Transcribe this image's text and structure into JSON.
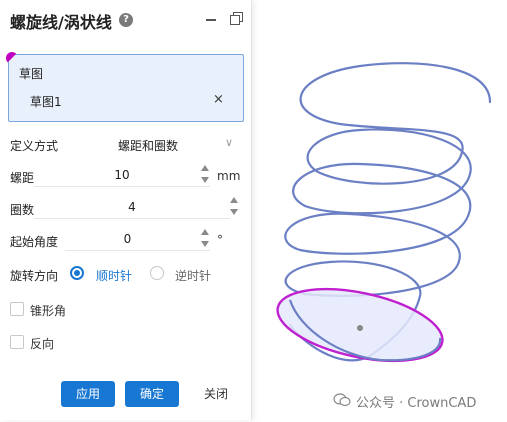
{
  "panel": {
    "title": "螺旋线/涡状线",
    "help_icon": "?",
    "sketch": {
      "label": "草图",
      "item": "草图1",
      "remove": "×"
    },
    "definition": {
      "label": "定义方式",
      "value": "螺距和圈数"
    },
    "pitch": {
      "label": "螺距",
      "value": "10",
      "unit": "mm"
    },
    "turns": {
      "label": "圈数",
      "value": "4"
    },
    "start_angle": {
      "label": "起始角度",
      "value": "0",
      "unit": "°"
    },
    "rotation": {
      "label": "旋转方向",
      "options": [
        "顺时针",
        "逆时针"
      ],
      "selected": "顺时针"
    },
    "taper": {
      "label": "锥形角",
      "checked": false
    },
    "reverse": {
      "label": "反向",
      "checked": false
    },
    "buttons": {
      "apply": "应用",
      "ok": "确定",
      "close": "关闭"
    }
  },
  "watermark": {
    "text": "公众号 · CrownCAD"
  },
  "colors": {
    "accent": "#1877d2",
    "helix": "#6b7fc4",
    "profile": "#c020d0",
    "selection_fill": "#e8f0fb"
  },
  "icons": [
    "help-icon",
    "minimize-icon",
    "restore-icon",
    "close-icon",
    "chevron-down-icon",
    "wechat-icon"
  ]
}
